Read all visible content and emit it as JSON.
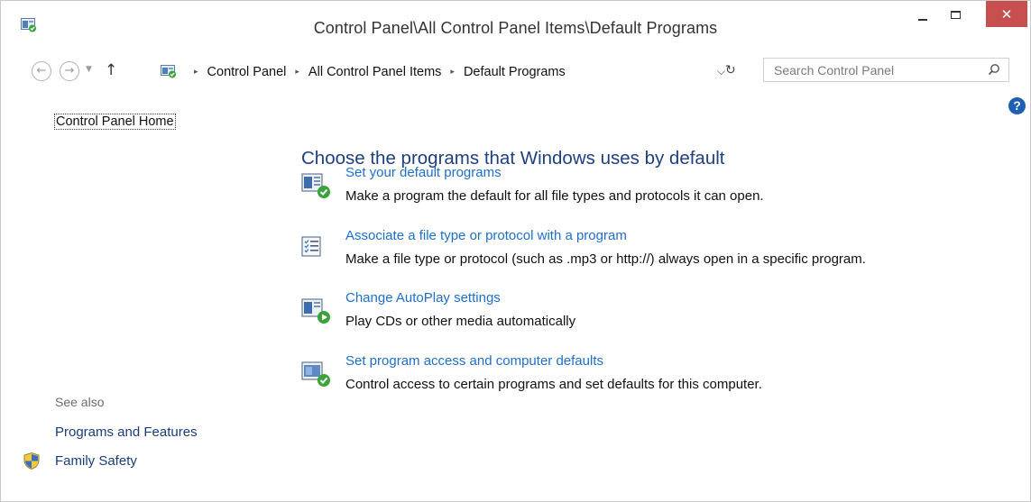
{
  "window": {
    "title": "Control Panel\\All Control Panel Items\\Default Programs",
    "close_glyph": "✕"
  },
  "nav": {
    "back_glyph": "←",
    "forward_glyph": "→",
    "recent_glyph": "▼",
    "up_glyph": "↑",
    "separator_glyph": "▸",
    "dropdown_glyph": "⌵",
    "refresh_glyph": "↻",
    "breadcrumbs": [
      "Control Panel",
      "All Control Panel Items",
      "Default Programs"
    ],
    "search_placeholder": "Search Control Panel"
  },
  "help": {
    "glyph": "?"
  },
  "sidebar": {
    "home_label": "Control Panel Home",
    "see_also_label": "See also",
    "links": [
      {
        "label": "Programs and Features"
      },
      {
        "label": "Family Safety"
      }
    ]
  },
  "main": {
    "heading": "Choose the programs that Windows uses by default",
    "tasks": [
      {
        "link": "Set your default programs",
        "description": "Make a program the default for all file types and protocols it can open.",
        "icon": "default-programs-icon"
      },
      {
        "link": "Associate a file type or protocol with a program",
        "description": "Make a file type or protocol (such as .mp3 or http://) always open in a specific program.",
        "icon": "file-association-icon"
      },
      {
        "link": "Change AutoPlay settings",
        "description": "Play CDs or other media automatically",
        "icon": "autoplay-icon"
      },
      {
        "link": "Set program access and computer defaults",
        "description": "Control access to certain programs and set defaults for this computer.",
        "icon": "program-access-icon"
      }
    ]
  },
  "colors": {
    "link": "#1e6fcc",
    "heading": "#1e3f83",
    "close_button": "#c74f50",
    "check_green": "#3aa33a"
  }
}
